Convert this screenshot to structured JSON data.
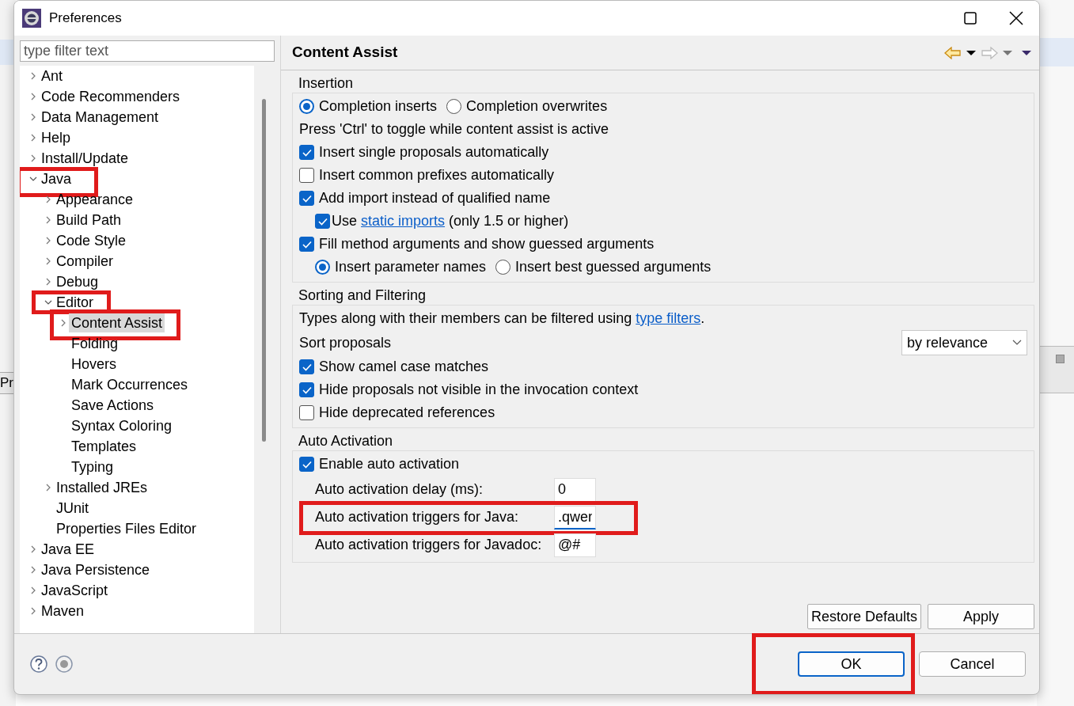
{
  "backdrop": {
    "tab_label": "Pr"
  },
  "window": {
    "title": "Preferences"
  },
  "filter": {
    "placeholder": "type filter text"
  },
  "tree": [
    {
      "label": "Ant",
      "expanded": false,
      "selected": false,
      "highlighted": false
    },
    {
      "label": "Code Recommenders",
      "expanded": false,
      "selected": false,
      "highlighted": false
    },
    {
      "label": "Data Management",
      "expanded": false,
      "selected": false,
      "highlighted": false
    },
    {
      "label": "Help",
      "expanded": false,
      "selected": false,
      "highlighted": false
    },
    {
      "label": "Install/Update",
      "expanded": false,
      "selected": false,
      "highlighted": false
    },
    {
      "label": "Java",
      "expanded": true,
      "selected": false,
      "highlighted": true,
      "children": [
        {
          "label": "Appearance",
          "expanded": false,
          "selected": false,
          "highlighted": false
        },
        {
          "label": "Build Path",
          "expanded": false,
          "selected": false,
          "highlighted": false
        },
        {
          "label": "Code Style",
          "expanded": false,
          "selected": false,
          "highlighted": false
        },
        {
          "label": "Compiler",
          "expanded": false,
          "selected": false,
          "highlighted": false
        },
        {
          "label": "Debug",
          "expanded": false,
          "selected": false,
          "highlighted": false
        },
        {
          "label": "Editor",
          "expanded": true,
          "selected": false,
          "highlighted": true,
          "children": [
            {
              "label": "Content Assist",
              "expanded": false,
              "selected": true,
              "highlighted": true
            },
            {
              "label": "Folding",
              "selected": false,
              "highlighted": false
            },
            {
              "label": "Hovers",
              "selected": false,
              "highlighted": false
            },
            {
              "label": "Mark Occurrences",
              "selected": false,
              "highlighted": false
            },
            {
              "label": "Save Actions",
              "selected": false,
              "highlighted": false
            },
            {
              "label": "Syntax Coloring",
              "selected": false,
              "highlighted": false
            },
            {
              "label": "Templates",
              "selected": false,
              "highlighted": false
            },
            {
              "label": "Typing",
              "selected": false,
              "highlighted": false
            }
          ]
        },
        {
          "label": "Installed JREs",
          "expanded": false,
          "selected": false,
          "highlighted": false
        },
        {
          "label": "JUnit",
          "selected": false,
          "highlighted": false
        },
        {
          "label": "Properties Files Editor",
          "selected": false,
          "highlighted": false
        }
      ]
    },
    {
      "label": "Java EE",
      "expanded": false,
      "selected": false,
      "highlighted": false
    },
    {
      "label": "Java Persistence",
      "expanded": false,
      "selected": false,
      "highlighted": false
    },
    {
      "label": "JavaScript",
      "expanded": false,
      "selected": false,
      "highlighted": false
    },
    {
      "label": "Maven",
      "expanded": false,
      "selected": false,
      "highlighted": false
    }
  ],
  "page": {
    "title": "Content Assist",
    "groups": [
      {
        "title": "Insertion",
        "rows": [
          {
            "kind": "radios",
            "options": [
              {
                "label": "Completion inserts",
                "selected": true
              },
              {
                "label": "Completion overwrites",
                "selected": false
              }
            ]
          },
          {
            "kind": "note",
            "text": "Press 'Ctrl' to toggle while content assist is active"
          },
          {
            "kind": "checkbox",
            "label": "Insert single proposals automatically",
            "checked": true
          },
          {
            "kind": "checkbox",
            "label": "Insert common prefixes automatically",
            "checked": false
          },
          {
            "kind": "checkbox",
            "label": "Add import instead of qualified name",
            "checked": true,
            "children": [
              {
                "kind": "checkbox",
                "label": "Use",
                "link": "static imports",
                "after": "(only 1.5 or higher)",
                "checked": true
              }
            ]
          },
          {
            "kind": "checkbox",
            "label": "Fill method arguments and show guessed arguments",
            "checked": true,
            "children": [
              {
                "kind": "radios",
                "options": [
                  {
                    "label": "Insert parameter names",
                    "selected": true
                  },
                  {
                    "label": "Insert best guessed arguments",
                    "selected": false
                  }
                ]
              }
            ]
          }
        ]
      },
      {
        "title": "Sorting and Filtering",
        "rows": [
          {
            "kind": "note",
            "text": "Types along with their members can be filtered using",
            "link": "type filters",
            "after": "."
          },
          {
            "kind": "select",
            "label": "Sort proposals",
            "value": "by relevance"
          },
          {
            "kind": "checkbox",
            "label": "Show camel case matches",
            "checked": true
          },
          {
            "kind": "checkbox",
            "label": "Hide proposals not visible in the invocation context",
            "checked": true
          },
          {
            "kind": "checkbox",
            "label": "Hide deprecated references",
            "checked": false
          }
        ]
      },
      {
        "title": "Auto Activation",
        "rows": [
          {
            "kind": "checkbox",
            "label": "Enable auto activation",
            "checked": true
          },
          {
            "kind": "field",
            "label": "Auto activation delay (ms):",
            "value": "0",
            "focused": false,
            "highlighted": false
          },
          {
            "kind": "field",
            "label": "Auto activation triggers for Java:",
            "value": ".qwer",
            "focused": true,
            "highlighted": true
          },
          {
            "kind": "field",
            "label": "Auto activation triggers for Javadoc:",
            "value": "@#",
            "focused": false,
            "highlighted": false
          }
        ]
      }
    ]
  },
  "page_buttons": [
    {
      "label": "Restore Defaults"
    },
    {
      "label": "Apply"
    }
  ],
  "dialog_buttons": [
    {
      "label": "OK",
      "default": true,
      "highlighted": true
    },
    {
      "label": "Cancel",
      "default": false,
      "highlighted": false
    }
  ]
}
